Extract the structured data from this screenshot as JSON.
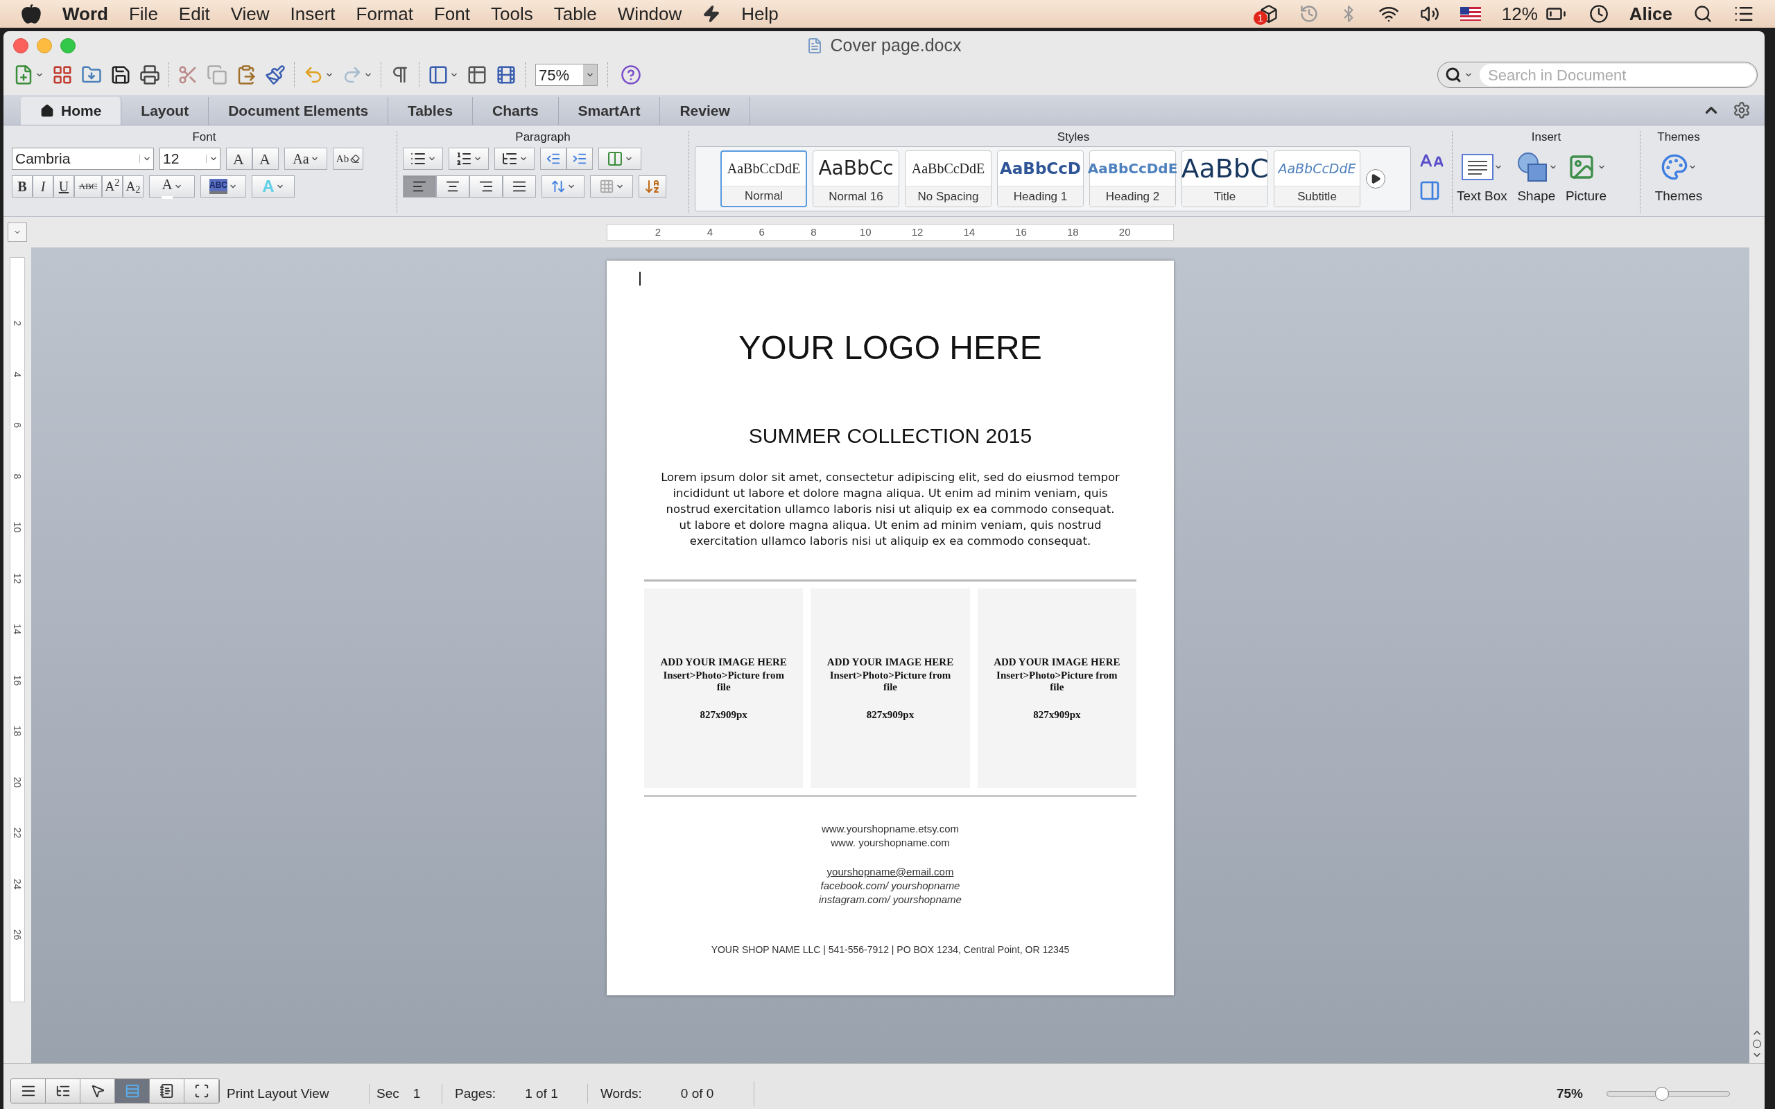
{
  "menu_bar": {
    "app_name": "Word",
    "items": [
      "File",
      "Edit",
      "View",
      "Insert",
      "Format",
      "Font",
      "Tools",
      "Table",
      "Window",
      "Help"
    ],
    "notification_badge": "1",
    "battery_reading": "12%",
    "user": "Alice"
  },
  "window": {
    "title": "Cover page.docx"
  },
  "toolbar": {
    "zoom": "75%",
    "search": {
      "placeholder": "Search in Document"
    }
  },
  "ribbon_tabs": [
    {
      "label": "Home",
      "selected": true
    },
    {
      "label": "Layout",
      "selected": false
    },
    {
      "label": "Document Elements",
      "selected": false
    },
    {
      "label": "Tables",
      "selected": false
    },
    {
      "label": "Charts",
      "selected": false
    },
    {
      "label": "SmartArt",
      "selected": false
    },
    {
      "label": "Review",
      "selected": false
    }
  ],
  "ribbon": {
    "font": {
      "title": "Font",
      "font_name": "Cambria",
      "font_size": "12",
      "size_buttons": [
        "A",
        "A"
      ],
      "case_button": "Aa",
      "clear_button": "Ab",
      "format_buttons": [
        "B",
        "I",
        "U",
        "ABC",
        "A$^{2}$",
        "A$_{2}$"
      ],
      "color_buttons": [
        "A",
        "ABC",
        "A"
      ]
    },
    "paragraph": {
      "title": "Paragraph",
      "alignment": [
        {
          "selected": true
        },
        {
          "selected": false
        },
        {
          "selected": false
        },
        {
          "selected": false
        }
      ]
    },
    "styles": {
      "title": "Styles",
      "items": [
        {
          "sample": "AaBbCcDdE",
          "label": "Normal",
          "kind": "normal",
          "selected": true
        },
        {
          "sample": "AaBbCc",
          "label": "Normal 16",
          "kind": "large",
          "selected": false
        },
        {
          "sample": "AaBbCcDdE",
          "label": "No Spacing",
          "kind": "normal",
          "selected": false
        },
        {
          "sample": "AaBbCcD",
          "label": "Heading 1",
          "kind": "heading1",
          "selected": false
        },
        {
          "sample": "AaBbCcDdE",
          "label": "Heading 2",
          "kind": "heading2",
          "selected": false
        },
        {
          "sample": "AaBbC",
          "label": "Title",
          "kind": "title",
          "selected": false
        },
        {
          "sample": "AaBbCcDdE",
          "label": "Subtitle",
          "kind": "subtitle",
          "selected": false
        }
      ]
    },
    "insert": {
      "title": "Insert",
      "items": [
        "Text Box",
        "Shape",
        "Picture"
      ]
    },
    "themes": {
      "title": "Themes",
      "label": "Themes"
    }
  },
  "ruler": {
    "marks": [
      "2",
      "4",
      "6",
      "8",
      "10",
      "12",
      "14",
      "16",
      "18",
      "20"
    ]
  },
  "vertical_ruler": {
    "marks": [
      "2",
      "4",
      "6",
      "8",
      "10",
      "12",
      "14",
      "16",
      "18",
      "20",
      "22",
      "24",
      "26"
    ]
  },
  "document": {
    "logo": "YOUR LOGO HERE",
    "heading": "SUMMER COLLECTION 2015",
    "paragraphs": [
      "Lorem ipsum dolor sit amet, consectetur adipiscing elit, sed do eiusmod tempor incididunt ut labore et dolore magna aliqua. Ut enim ad minim veniam, quis nostrud exercitation ullamco laboris nisi ut aliquip ex ea commodo consequat.",
      "ut labore et dolore magna aliqua. Ut enim ad minim veniam, quis nostrud exercitation ullamco laboris nisi ut aliquip ex ea commodo consequat."
    ],
    "image_placeholders": [
      {
        "title": "ADD YOUR IMAGE HERE",
        "instruction": "Insert>Photo>Picture from file",
        "size": "827x909px"
      },
      {
        "title": "ADD YOUR IMAGE HERE",
        "instruction": "Insert>Photo>Picture from file",
        "size": "827x909px"
      },
      {
        "title": "ADD YOUR IMAGE HERE",
        "instruction": "Insert>Photo>Picture from file",
        "size": "827x909px"
      }
    ],
    "contact_lines": [
      {
        "text": "www.yourshopname.etsy.com",
        "kind": "web"
      },
      {
        "text": "www. yourshopname.com",
        "kind": "web"
      },
      {
        "text": "yourshopname@email.com",
        "kind": "email"
      },
      {
        "text": "facebook.com/ yourshopname",
        "kind": "social"
      },
      {
        "text": "instagram.com/ yourshopname",
        "kind": "social"
      }
    ],
    "footer": "YOUR SHOP NAME LLC | 541-556-7912 | PO BOX 1234, Central Point, OR 12345"
  },
  "status_bar": {
    "views": [
      {
        "selected": false
      },
      {
        "selected": false
      },
      {
        "selected": false
      },
      {
        "selected": true
      },
      {
        "selected": false
      },
      {
        "selected": false
      }
    ],
    "view_name": "Print Layout View",
    "section": {
      "label": "Sec",
      "value": "1"
    },
    "pages": {
      "label": "Pages:",
      "value": "1 of 1"
    },
    "words": {
      "label": "Words:",
      "value": "0 of 0"
    },
    "zoom": {
      "reading": "75%",
      "level": 0.45
    }
  }
}
